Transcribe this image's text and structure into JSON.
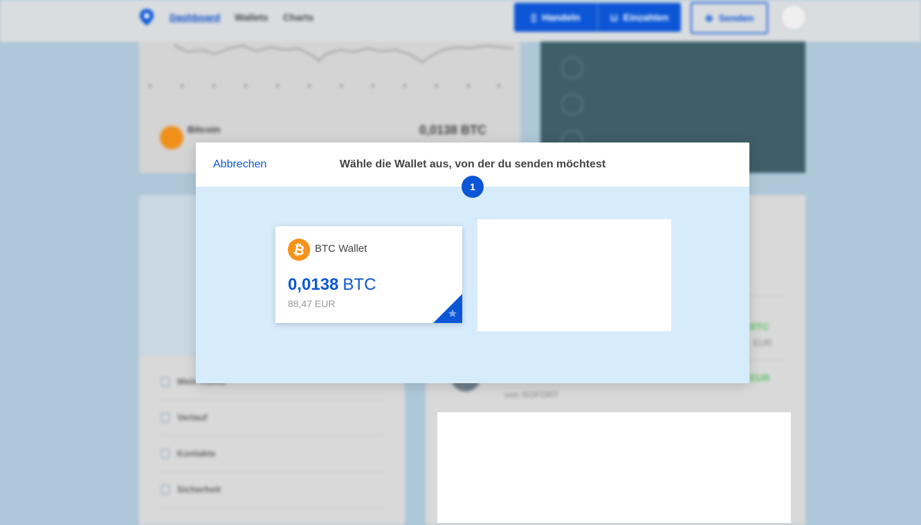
{
  "background": {
    "nav": {
      "dashboard": "Dashboard",
      "wallets": "Wallets",
      "charts": "Charts"
    },
    "actions": {
      "trade": "Handeln",
      "deposit": "Einzahlen",
      "send": "Senden"
    },
    "asset": {
      "name": "Bitcoin",
      "balance": "0,0138 BTC"
    },
    "sidebar": [
      "Mein Konto",
      "Verlauf",
      "Kontakte",
      "Sicherheit"
    ],
    "transactions": {
      "amount_unit": "BTC",
      "fiat_unit": "EUR",
      "source": "von SOFORT"
    }
  },
  "modal": {
    "cancel_label": "Abbrechen",
    "title": "Wähle die Wallet aus, von der du senden möchtest",
    "step": "1",
    "wallet": {
      "name": "BTC Wallet",
      "amount": "0,0138",
      "unit": "BTC",
      "fiat": "88,47 EUR",
      "icon": "bitcoin-icon",
      "favorite_icon": "star-icon"
    }
  },
  "colors": {
    "accent": "#0c56d6",
    "bitcoin": "#f7931a",
    "overlay_background": "#d6ecfa"
  }
}
